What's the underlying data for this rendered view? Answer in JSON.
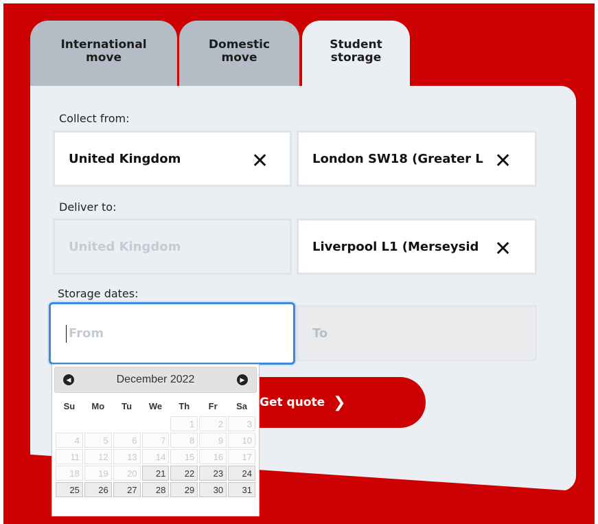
{
  "tabs": [
    {
      "line1": "International",
      "line2": "move"
    },
    {
      "line1": "Domestic",
      "line2": "move"
    },
    {
      "line1": "Student",
      "line2": "storage"
    }
  ],
  "form": {
    "collect_label": "Collect from:",
    "collect_country": "United Kingdom",
    "collect_city": "London SW18 (Greater L",
    "deliver_label": "Deliver to:",
    "deliver_country": "United Kingdom",
    "deliver_city": "Liverpool L1 (Merseysid",
    "dates_label": "Storage dates:",
    "from_placeholder": "From",
    "to_placeholder": "To",
    "clear_symbol": "✕"
  },
  "quote_button": {
    "label": "Get quote",
    "chevron": "❯"
  },
  "calendar": {
    "month": "December 2022",
    "prev_symbol": "◀",
    "next_symbol": "▶",
    "weekdays": [
      "Su",
      "Mo",
      "Tu",
      "We",
      "Th",
      "Fr",
      "Sa"
    ],
    "weeks": [
      [
        "",
        "",
        "",
        "",
        "1",
        "2",
        "3"
      ],
      [
        "4",
        "5",
        "6",
        "7",
        "8",
        "9",
        "10"
      ],
      [
        "11",
        "12",
        "13",
        "14",
        "15",
        "16",
        "17"
      ],
      [
        "18",
        "19",
        "20",
        "21",
        "22",
        "23",
        "24"
      ],
      [
        "25",
        "26",
        "27",
        "28",
        "29",
        "30",
        "31"
      ]
    ],
    "first_selectable_day": 21
  },
  "colors": {
    "brand_red": "#cc0001",
    "card_bg": "#ebeff4",
    "inactive_tab": "#b4bcc6",
    "focus_blue": "#3a8ad8"
  }
}
